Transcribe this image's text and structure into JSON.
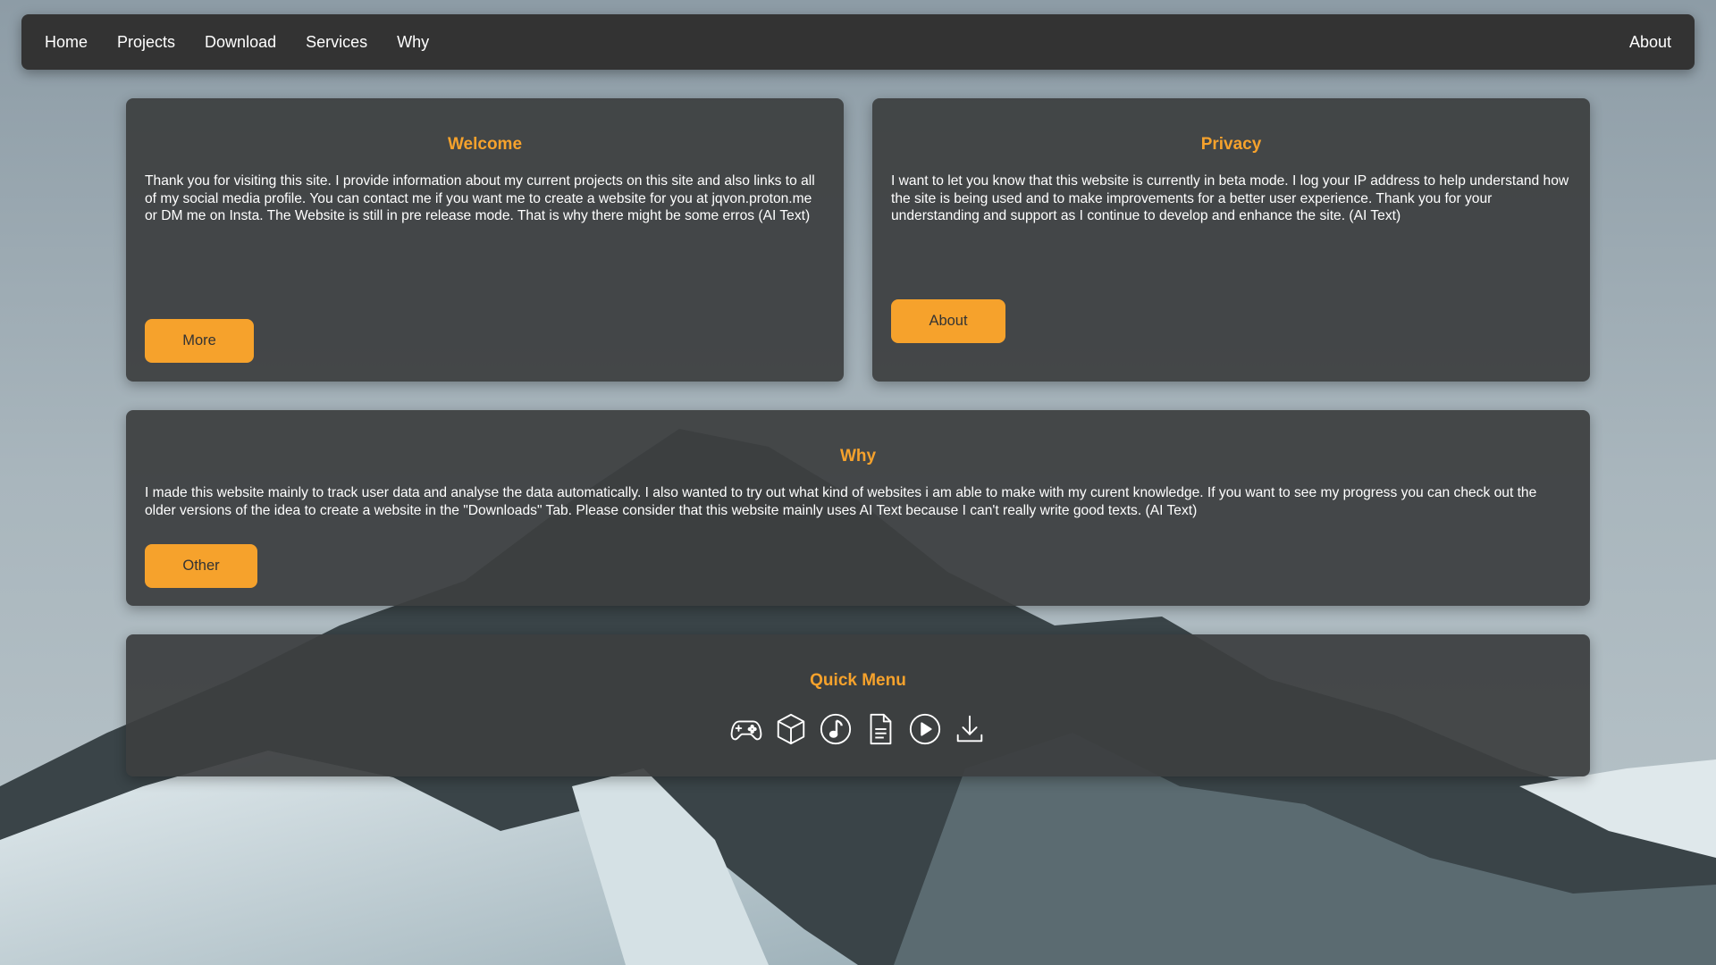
{
  "nav": {
    "links": [
      "Home",
      "Projects",
      "Download",
      "Services",
      "Why"
    ],
    "right_link": "About"
  },
  "welcome": {
    "title": "Welcome",
    "text": "Thank you for visiting this site. I provide information about my current projects on this site and also links to all of my social media profile. You can contact me if you want me to create a website for you at jqvon.proton.me or DM me on Insta. The Website is still in pre release mode. That is why there might be some erros (AI Text)",
    "button": "More"
  },
  "privacy": {
    "title": "Privacy",
    "text": "I want to let you know that this website is currently in beta mode. I log your IP address to help understand how the site is being used and to make improvements for a better user experience. Thank you for your understanding and support as I continue to develop and enhance the site. (AI Text)",
    "button": "About"
  },
  "why": {
    "title": "Why",
    "text": "I made this website mainly to track user data and analyse the data automatically. I also wanted to try out what kind of websites i am able to make with my curent knowledge. If you want to see my progress you can check out the older versions of the idea to create a website in the \"Downloads\" Tab. Please consider that this website mainly uses AI Text because I can't really write good texts. (AI Text)",
    "button": "Other"
  },
  "quick_menu": {
    "title": "Quick Menu",
    "icons": [
      "gamepad-icon",
      "cube-icon",
      "music-icon",
      "document-icon",
      "play-icon",
      "download-icon"
    ]
  },
  "colors": {
    "accent": "#f6a22c",
    "navbar": "#333333",
    "card": "#3c3e40"
  }
}
